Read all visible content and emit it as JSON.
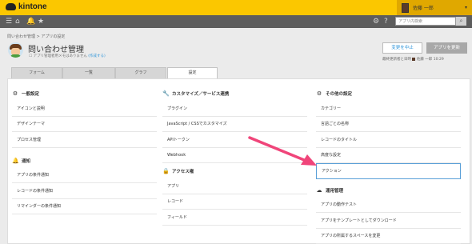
{
  "header": {
    "logo_text": "kintone",
    "user_name": "佐藤 一郎",
    "search_placeholder": "アプリ内検索"
  },
  "breadcrumb": "問い合わせ管理  >  アプリの設定",
  "app": {
    "title": "問い合わせ管理",
    "sub_text": "アプリ管理者用メモはありません",
    "sub_link": "(作成する)"
  },
  "actions": {
    "cancel_label": "変更を中止",
    "update_label": "アプリを更新"
  },
  "last_updated": {
    "label": "最終更新者と日時",
    "user": "佐藤 一郎",
    "time": "10:29"
  },
  "tabs": [
    {
      "label": "フォーム"
    },
    {
      "label": "一覧"
    },
    {
      "label": "グラフ"
    },
    {
      "label": "設定"
    }
  ],
  "columns": [
    {
      "sections": [
        {
          "title": "一般設定",
          "icon": "gear-icon",
          "items": [
            "アイコンと説明",
            "デザインテーマ",
            "プロセス管理"
          ]
        },
        {
          "title": "通知",
          "icon": "bell-icon",
          "items": [
            "アプリの条件通知",
            "レコードの条件通知",
            "リマインダーの条件通知"
          ]
        }
      ]
    },
    {
      "sections": [
        {
          "title": "カスタマイズ／サービス連携",
          "icon": "wrench-icon",
          "items": [
            "プラグイン",
            "JavaScript / CSSでカスタマイズ",
            "APIトークン",
            "Webhook"
          ]
        },
        {
          "title": "アクセス権",
          "icon": "lock-icon",
          "items": [
            "アプリ",
            "レコード",
            "フィールド"
          ]
        }
      ]
    },
    {
      "sections": [
        {
          "title": "その他の設定",
          "icon": "gears-icon",
          "items": [
            "カテゴリー",
            "言語ごとの名称",
            "レコードのタイトル",
            "高度な設定",
            "アクション"
          ]
        },
        {
          "title": "運用管理",
          "icon": "cloud-icon",
          "items": [
            "アプリの動作テスト",
            "アプリをテンプレートとしてダウンロード",
            "アプリの所属するスペースを変更"
          ]
        }
      ]
    }
  ],
  "highlight_color": "#f0457a"
}
